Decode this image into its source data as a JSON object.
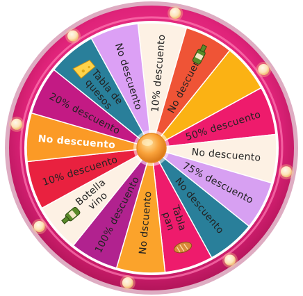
{
  "wheel": {
    "segments": [
      {
        "label": "10% descuento",
        "lines": [
          "10% descuento"
        ],
        "color": "#fdf1e4",
        "text_color": "#222222",
        "icon": null
      },
      {
        "label": "No descuento",
        "lines": [
          "No descuento"
        ],
        "color": "#ef5436",
        "text_color": "#222222",
        "icon": "wine-bottle-icon"
      },
      {
        "label": "",
        "lines": [],
        "color": "#fbb214",
        "text_color": "#222222",
        "icon": null
      },
      {
        "label": "50% descuento",
        "lines": [
          "50% descuento"
        ],
        "color": "#ee1b6c",
        "text_color": "#222222",
        "icon": null
      },
      {
        "label": "No descuento",
        "lines": [
          "No descuento"
        ],
        "color": "#fdf1e4",
        "text_color": "#222222",
        "icon": null
      },
      {
        "label": "75% descuento",
        "lines": [
          "75% descuento"
        ],
        "color": "#d7a0f2",
        "text_color": "#222222",
        "icon": null
      },
      {
        "label": "No descuento",
        "lines": [
          "No descuento"
        ],
        "color": "#297f9a",
        "text_color": "#222222",
        "icon": null
      },
      {
        "label": "Tabla pan",
        "lines": [
          "Tabla",
          "pan"
        ],
        "color": "#ee1b6c",
        "text_color": "#222222",
        "icon": "bread-icon"
      },
      {
        "label": "No dscuento",
        "lines": [
          "No dscuento"
        ],
        "color": "#fba32b",
        "text_color": "#222222",
        "icon": null
      },
      {
        "label": "100% descuento",
        "lines": [
          "100% descuento"
        ],
        "color": "#b1228f",
        "text_color": "#222222",
        "icon": null
      },
      {
        "label": "Botella vino",
        "lines": [
          "Botella",
          "vino"
        ],
        "color": "#fdf1e4",
        "text_color": "#222222",
        "icon": "wine-bottle-icon"
      },
      {
        "label": "10% descuento",
        "lines": [
          "10% descuento"
        ],
        "color": "#e9213f",
        "text_color": "#222222",
        "icon": null
      },
      {
        "label": "No descuento",
        "lines": [
          "No descuento"
        ],
        "color": "#fb9a26",
        "text_color": "#ffffff",
        "icon": null
      },
      {
        "label": "20% descuento",
        "lines": [
          "20% descuento"
        ],
        "color": "#c31a84",
        "text_color": "#222222",
        "icon": null
      },
      {
        "label": "Tabla de quesos",
        "lines": [
          "Tabla de",
          "quesos"
        ],
        "color": "#297f9a",
        "text_color": "#222222",
        "icon": "cheese-icon"
      },
      {
        "label": "No descuento",
        "lines": [
          "No descuento"
        ],
        "color": "#dca0f5",
        "text_color": "#222222",
        "icon": null
      }
    ],
    "colors": {
      "rim_outer": "#d21a6c",
      "rim_inner": "#f03c8c",
      "rim_highlight": "#ff7ab4",
      "bulb": "#fde3b8",
      "bulb_glow": "#ffd08a",
      "hub": "#f9a23a",
      "hub_highlight": "#ffd27a",
      "divider": "#ffffff"
    }
  }
}
